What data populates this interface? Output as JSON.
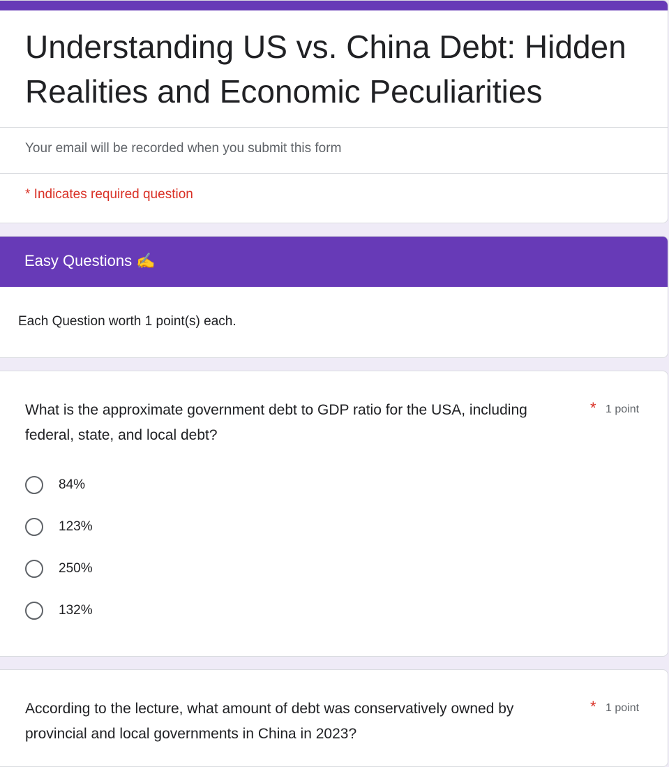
{
  "form": {
    "title": "Understanding US vs. China Debt: Hidden Realities and Economic Peculiarities",
    "email_notice": "Your email will be recorded when you submit this form",
    "required_notice": "* Indicates required question",
    "theme_color": "#673ab7",
    "background_color": "#efebf7",
    "required_color": "#d93025"
  },
  "section": {
    "title": "Easy Questions ✍️",
    "description": "Each Question worth 1 point(s) each."
  },
  "questions": [
    {
      "text": "What is the approximate government debt to GDP ratio for the USA, including federal, state, and local debt?",
      "required_marker": "*",
      "points": "1 point",
      "options": [
        "84%",
        "123%",
        "250%",
        "132%"
      ]
    },
    {
      "text": "According to the lecture, what amount of debt was conservatively owned by provincial and local governments in China in 2023?",
      "required_marker": "*",
      "points": "1 point"
    }
  ]
}
